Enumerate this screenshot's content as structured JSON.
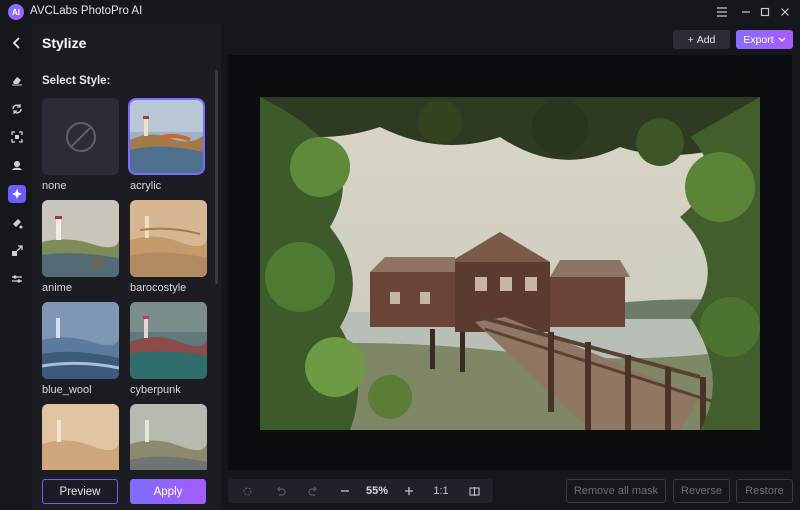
{
  "app": {
    "title": "AVCLabs PhotoPro AI",
    "logo_text": "AI"
  },
  "window_controls": [
    "menu-icon",
    "minimize-icon",
    "maximize-icon",
    "close-icon"
  ],
  "rail": {
    "back_icon": "chevron-left-icon",
    "tools": [
      {
        "name": "eraser-icon",
        "active": false
      },
      {
        "name": "replace-icon",
        "active": false
      },
      {
        "name": "enhance-icon",
        "active": false
      },
      {
        "name": "background-icon",
        "active": false
      },
      {
        "name": "stylize-icon",
        "active": true
      },
      {
        "name": "colorize-icon",
        "active": false
      },
      {
        "name": "resize-icon",
        "active": false
      },
      {
        "name": "adjust-icon",
        "active": false
      }
    ]
  },
  "panel": {
    "title": "Stylize",
    "select_label": "Select Style:",
    "styles": [
      {
        "label": "none",
        "selected": false
      },
      {
        "label": "acrylic",
        "selected": true
      },
      {
        "label": "anime",
        "selected": false
      },
      {
        "label": "barocostyle",
        "selected": false
      },
      {
        "label": "blue_wool",
        "selected": false
      },
      {
        "label": "cyberpunk",
        "selected": false
      },
      {
        "label": "",
        "selected": false
      },
      {
        "label": "",
        "selected": false
      }
    ],
    "preview_label": "Preview",
    "apply_label": "Apply"
  },
  "header": {
    "add_label": "Add",
    "export_label": "Export"
  },
  "toolbar": {
    "zoom_value": "55%",
    "actual_size_label": "1:1",
    "remove_mask_label": "Remove all mask",
    "reverse_label": "Reverse",
    "restore_label": "Restore"
  },
  "colors": {
    "accent": "#6d5cff",
    "accent_gradient_end": "#a65cff",
    "background": "#16171c",
    "panel": "#1c1d23"
  }
}
